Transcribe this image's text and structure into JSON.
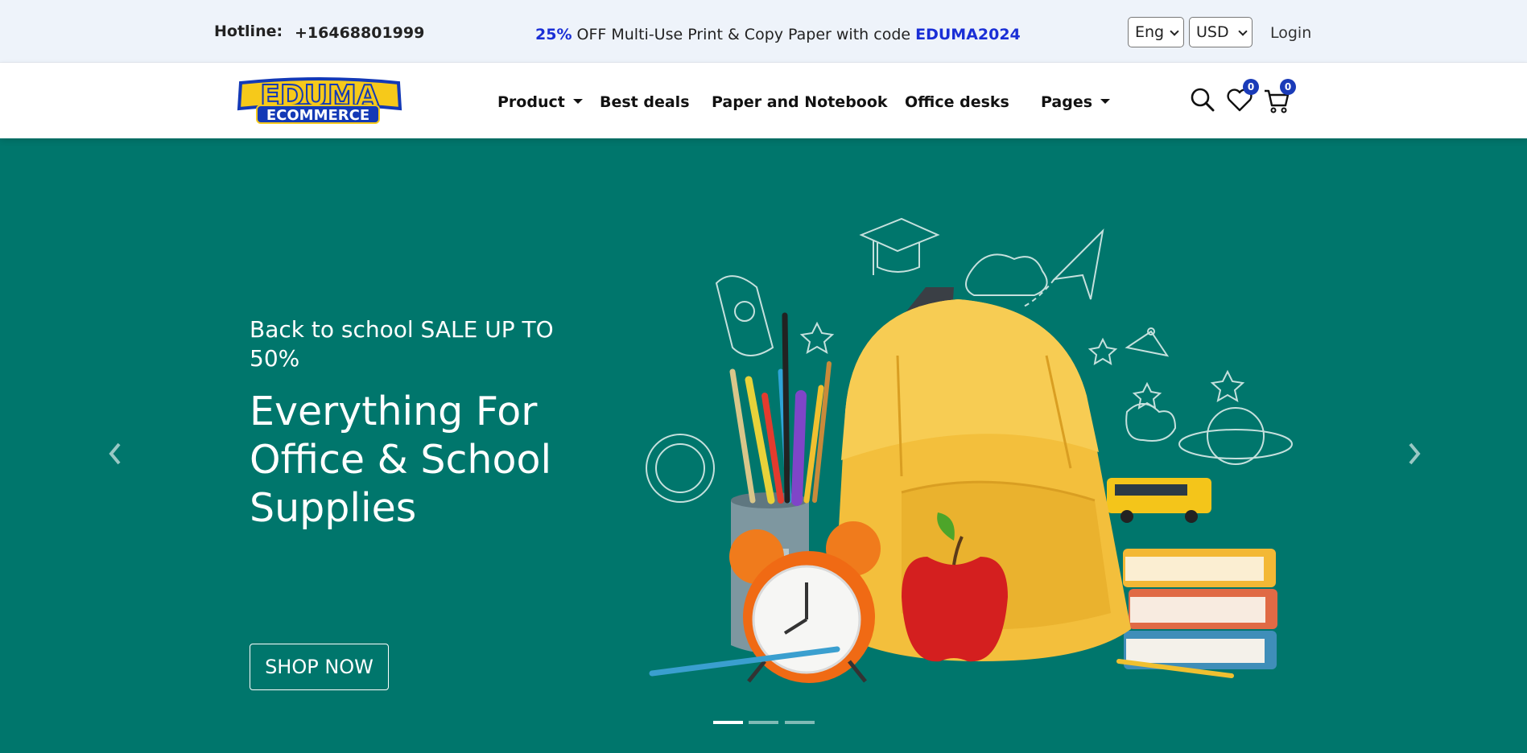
{
  "topbar": {
    "hotline_label": "Hotline:",
    "hotline_number": "+16468801999",
    "promo_percent": "25%",
    "promo_text": " OFF Multi-Use Print & Copy Paper with code ",
    "promo_code": "EDUMA2024",
    "language": "Eng",
    "currency": "USD",
    "login": "Login"
  },
  "logo": {
    "line1": "EDUMA",
    "line2": "ECOMMERCE"
  },
  "nav": {
    "items": [
      {
        "label": "Product"
      },
      {
        "label": "Best deals"
      },
      {
        "label": "Paper and Notebook"
      },
      {
        "label": "Office desks"
      },
      {
        "label": "Pages"
      }
    ],
    "wishlist_count": "0",
    "cart_count": "0"
  },
  "hero": {
    "eyebrow": "Back to school SALE UP TO 50%",
    "headline": "Everything For Office & School Supplies",
    "cta": "SHOP NOW",
    "slide_count": 3,
    "active_slide": 1
  },
  "colors": {
    "accent": "#1a2fd6",
    "hero_bg": "#00766c",
    "badge": "#1a3bb8",
    "logo_yellow": "#f6c91a",
    "logo_blue": "#1339b6"
  }
}
